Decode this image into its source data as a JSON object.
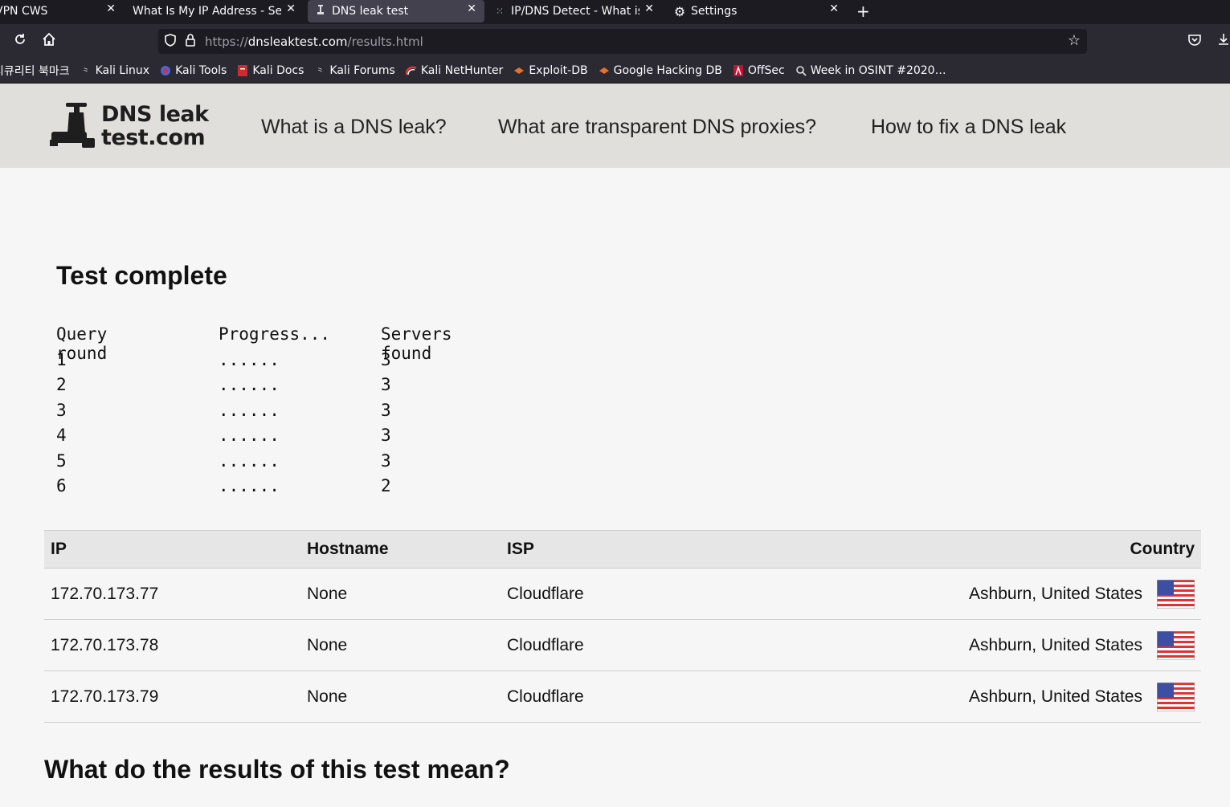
{
  "browser": {
    "tabs": [
      {
        "title": "VPN CWS",
        "active": false
      },
      {
        "title": "What Is My IP Address - See Y",
        "active": false
      },
      {
        "title": "DNS leak test",
        "active": true
      },
      {
        "title": "IP/DNS Detect - What is y",
        "active": false
      },
      {
        "title": "Settings",
        "active": false
      }
    ],
    "url": {
      "prefix": "https://",
      "domain": "dnsleaktest.com",
      "path": "/results.html"
    },
    "bookmarks": [
      {
        "label": "시큐리티 북마크",
        "icon": "folder-icon"
      },
      {
        "label": "Kali Linux",
        "icon": "kali-dragon-icon"
      },
      {
        "label": "Kali Tools",
        "icon": "kali-tools-icon"
      },
      {
        "label": "Kali Docs",
        "icon": "kali-docs-icon"
      },
      {
        "label": "Kali Forums",
        "icon": "kali-dragon-icon"
      },
      {
        "label": "Kali NetHunter",
        "icon": "nethunter-icon"
      },
      {
        "label": "Exploit-DB",
        "icon": "exploitdb-icon"
      },
      {
        "label": "Google Hacking DB",
        "icon": "exploitdb-icon"
      },
      {
        "label": "OffSec",
        "icon": "offsec-icon"
      },
      {
        "label": "Week in OSINT #2020…",
        "icon": "osint-icon"
      }
    ]
  },
  "site": {
    "logo_line1": "DNS leak",
    "logo_line2": "test.com",
    "nav": [
      "What is a DNS leak?",
      "What are transparent DNS proxies?",
      "How to fix a DNS leak"
    ]
  },
  "test": {
    "heading": "Test complete",
    "headers": [
      "Query round",
      "Progress...",
      "Servers found"
    ],
    "rounds": [
      {
        "round": "1",
        "progress": "......",
        "servers": "3"
      },
      {
        "round": "2",
        "progress": "......",
        "servers": "3"
      },
      {
        "round": "3",
        "progress": "......",
        "servers": "3"
      },
      {
        "round": "4",
        "progress": "......",
        "servers": "3"
      },
      {
        "round": "5",
        "progress": "......",
        "servers": "3"
      },
      {
        "round": "6",
        "progress": "......",
        "servers": "2"
      }
    ]
  },
  "results": {
    "headers": {
      "ip": "IP",
      "hostname": "Hostname",
      "isp": "ISP",
      "country": "Country"
    },
    "rows": [
      {
        "ip": "172.70.173.77",
        "hostname": "None",
        "isp": "Cloudflare",
        "country": "Ashburn, United States",
        "flag": "us-flag-icon"
      },
      {
        "ip": "172.70.173.78",
        "hostname": "None",
        "isp": "Cloudflare",
        "country": "Ashburn, United States",
        "flag": "us-flag-icon"
      },
      {
        "ip": "172.70.173.79",
        "hostname": "None",
        "isp": "Cloudflare",
        "country": "Ashburn, United States",
        "flag": "us-flag-icon"
      }
    ]
  },
  "explain_heading": "What do the results of this test mean?"
}
